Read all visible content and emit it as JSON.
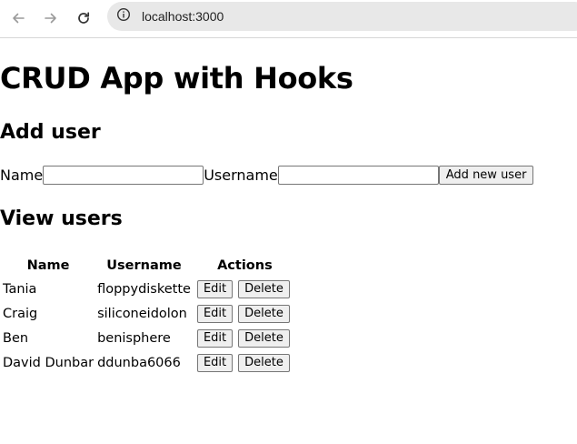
{
  "browser": {
    "url": "localhost:3000",
    "icons": {
      "back": "arrow-left-icon",
      "forward": "arrow-right-icon",
      "reload": "reload-icon",
      "site_info": "info-icon"
    }
  },
  "page": {
    "title": "CRUD App with Hooks",
    "add_section": {
      "heading": "Add user",
      "name_label": "Name",
      "name_value": "",
      "username_label": "Username",
      "username_value": "",
      "submit_label": "Add new user"
    },
    "view_section": {
      "heading": "View users",
      "columns": [
        "Name",
        "Username",
        "Actions"
      ],
      "edit_label": "Edit",
      "delete_label": "Delete",
      "rows": [
        {
          "name": "Tania",
          "username": "floppydiskette"
        },
        {
          "name": "Craig",
          "username": "siliconeidolon"
        },
        {
          "name": "Ben",
          "username": "benisphere"
        },
        {
          "name": "David Dunbar",
          "username": "ddunba6066"
        }
      ]
    }
  }
}
